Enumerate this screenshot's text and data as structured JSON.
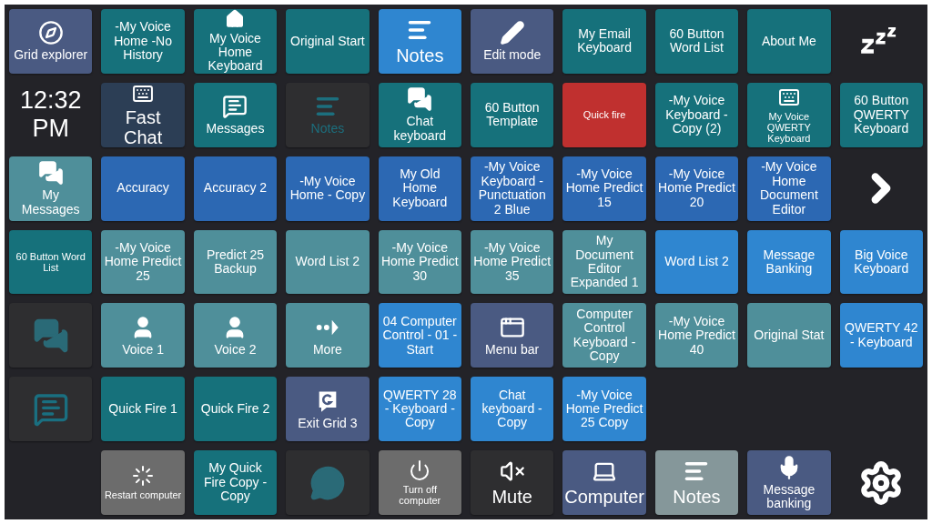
{
  "rows": [
    {
      "tiles": [
        {
          "kind": "tile",
          "label": "Grid explorer",
          "color": "#4a5a82"
        },
        {
          "kind": "tile",
          "label": "-My Voice Home -No History",
          "color": "#16717b"
        },
        {
          "kind": "tile",
          "label": "My Voice Home Keyboard",
          "color": "#16717b"
        },
        {
          "kind": "tile",
          "label": "Original Start",
          "color": "#16717b"
        },
        {
          "kind": "big-tile",
          "label": "Notes",
          "color": "#2f86d0"
        },
        {
          "kind": "tile",
          "label": "Edit mode",
          "color": "#4a5a82"
        },
        {
          "kind": "tile",
          "label": "My Email Keyboard",
          "color": "#16717b"
        },
        {
          "kind": "tile",
          "label": "60 Button Word List",
          "color": "#16717b"
        },
        {
          "kind": "tile",
          "label": "About Me",
          "color": "#16717b"
        },
        {
          "kind": "icon"
        }
      ]
    },
    {
      "tiles": [
        {
          "kind": "clock",
          "time": "12:32",
          "period": "PM"
        },
        {
          "kind": "big-tile",
          "label": "Fast Chat",
          "color": "#2c3e55"
        },
        {
          "kind": "tile",
          "label": "Messages",
          "color": "#16717b"
        },
        {
          "kind": "tile",
          "label": "Notes",
          "color": "#2e2e30"
        },
        {
          "kind": "tile",
          "label": "Chat keyboard",
          "color": "#16717b"
        },
        {
          "kind": "tile",
          "label": "60 Button Template",
          "color": "#16717b"
        },
        {
          "kind": "small-tile",
          "label": "Quick fire",
          "color": "#c0302f"
        },
        {
          "kind": "tile",
          "label": "-My Voice Keyboard - Copy (2)",
          "color": "#16717b"
        },
        {
          "kind": "small-tile",
          "label": "My Voice QWERTY Keyboard",
          "color": "#16717b"
        },
        {
          "kind": "tile",
          "label": "60 Button QWERTY Keyboard",
          "color": "#16717b"
        }
      ]
    },
    {
      "tiles": [
        {
          "kind": "tile",
          "label": "My Messages",
          "color": "#4f8f9a"
        },
        {
          "kind": "tile",
          "label": "Accuracy",
          "color": "#2c68b3"
        },
        {
          "kind": "tile",
          "label": "Accuracy 2",
          "color": "#2c68b3"
        },
        {
          "kind": "tile",
          "label": "-My Voice Home - Copy",
          "color": "#2c68b3"
        },
        {
          "kind": "tile",
          "label": "My Old Home Keyboard",
          "color": "#2c68b3"
        },
        {
          "kind": "tile",
          "label": "-My Voice Keyboard - Punctuation 2 Blue",
          "color": "#2c68b3"
        },
        {
          "kind": "tile",
          "label": "-My Voice Home Predict 15",
          "color": "#2c68b3"
        },
        {
          "kind": "tile",
          "label": "-My Voice Home Predict 20",
          "color": "#2c68b3"
        },
        {
          "kind": "tile",
          "label": "-My Voice Home Document Editor",
          "color": "#2c68b3"
        },
        {
          "kind": "icon"
        }
      ]
    },
    {
      "tiles": [
        {
          "kind": "small-tile",
          "label": "60 Button Word List",
          "color": "#16717b"
        },
        {
          "kind": "tile",
          "label": "-My Voice Home Predict 25",
          "color": "#4f8f9a"
        },
        {
          "kind": "tile",
          "label": "Predict 25 Backup",
          "color": "#4f8f9a"
        },
        {
          "kind": "tile",
          "label": "Word List 2",
          "color": "#4f8f9a"
        },
        {
          "kind": "tile",
          "label": "-My Voice Home Predict 30",
          "color": "#4f8f9a"
        },
        {
          "kind": "tile",
          "label": "-My Voice Home Predict 35",
          "color": "#4f8f9a"
        },
        {
          "kind": "tile",
          "label": "My Document Editor Expanded 1",
          "color": "#4f8f9a"
        },
        {
          "kind": "tile",
          "label": "Word List 2",
          "color": "#2f86d0"
        },
        {
          "kind": "tile",
          "label": "Message Banking",
          "color": "#2f86d0"
        },
        {
          "kind": "tile",
          "label": "Big Voice Keyboard",
          "color": "#2f86d0"
        }
      ]
    },
    {
      "tiles": [
        {
          "kind": "tile",
          "color": "#2e2e30"
        },
        {
          "kind": "tile",
          "label": "Voice 1",
          "color": "#4f8f9a"
        },
        {
          "kind": "tile",
          "label": "Voice 2",
          "color": "#4f8f9a"
        },
        {
          "kind": "tile",
          "label": "More",
          "color": "#4f8f9a"
        },
        {
          "kind": "tile",
          "label": "04 Computer Control - 01 - Start",
          "color": "#2f86d0"
        },
        {
          "kind": "tile",
          "label": "Menu bar",
          "color": "#4a5a82"
        },
        {
          "kind": "tile",
          "label": "Computer Control Keyboard - Copy",
          "color": "#4f8f9a"
        },
        {
          "kind": "tile",
          "label": "-My Voice Home Predict 40",
          "color": "#4f8f9a"
        },
        {
          "kind": "tile",
          "label": "Original Stat",
          "color": "#4f8f9a"
        },
        {
          "kind": "tile",
          "label": "QWERTY 42 - Keyboard",
          "color": "#2f86d0"
        }
      ]
    },
    {
      "tiles": [
        {
          "kind": "tile",
          "color": "#2e2e30"
        },
        {
          "kind": "tile",
          "label": "Quick Fire 1",
          "color": "#16717b"
        },
        {
          "kind": "tile",
          "label": "Quick Fire 2",
          "color": "#16717b"
        },
        {
          "kind": "tile",
          "label": "Exit Grid 3",
          "color": "#4a5a82"
        },
        {
          "kind": "tile",
          "label": "QWERTY 28 - Keyboard - Copy",
          "color": "#2f86d0"
        },
        {
          "kind": "tile",
          "label": "Chat keyboard - Copy",
          "color": "#2f86d0"
        },
        {
          "kind": "tile",
          "label": "-My Voice Home Predict 25 Copy",
          "color": "#2f86d0"
        },
        {
          "kind": "empty"
        },
        {
          "kind": "empty"
        },
        {
          "kind": "empty"
        }
      ]
    },
    {
      "tiles": [
        {
          "kind": "empty"
        },
        {
          "kind": "small-tile",
          "label": "Restart computer",
          "color": "#6c6c6c"
        },
        {
          "kind": "tile",
          "label": "My Quick Fire Copy - Copy",
          "color": "#16717b"
        },
        {
          "kind": "tile",
          "color": "#2e2e30"
        },
        {
          "kind": "small-tile",
          "label": "Turn off computer",
          "color": "#6c6c6c"
        },
        {
          "kind": "big-tile",
          "label": "Mute",
          "color": "#2e2e30"
        },
        {
          "kind": "big-tile",
          "label": "Computer",
          "color": "#4a5a82"
        },
        {
          "kind": "big-tile",
          "label": "Notes",
          "color": "#85979a"
        },
        {
          "kind": "tile",
          "label": "Message banking",
          "color": "#4a5a82"
        },
        {
          "kind": "icon"
        }
      ]
    }
  ]
}
